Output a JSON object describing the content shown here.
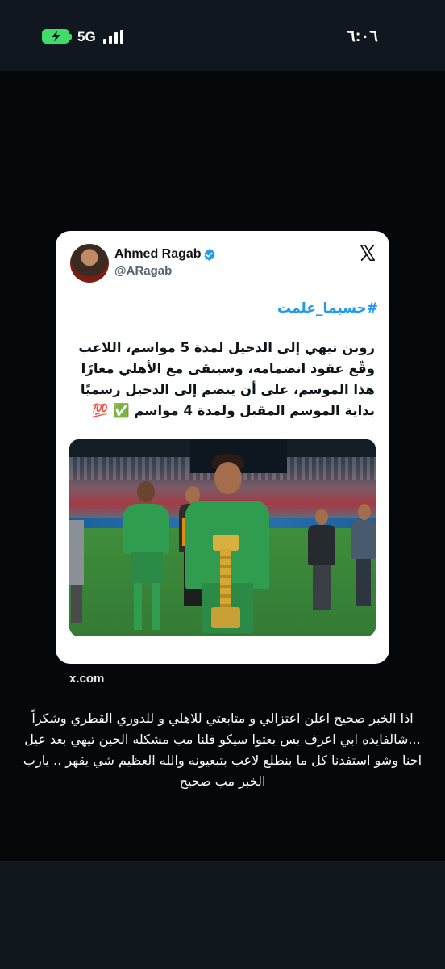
{
  "status_bar": {
    "network": "5G",
    "time": "٦:٠٦",
    "battery_color": "#3fdc6a",
    "icons": [
      "battery-charging-icon",
      "signal-bars-icon"
    ]
  },
  "tweet": {
    "author_name": "Ahmed Ragab",
    "handle": "@ARagab",
    "hashtag": "#حسبما_علمت",
    "text": "روبن تيهي إلى الدحيل لمدة 5 مواسم، اللاعب وقّع عقود انضمامه، وسيبقى مع الأهلي معارًا هذا الموسم، على أن ينضم إلى الدحيل رسميًا بداية الموسم المقبل ولمدة 4 مواسم ✅ 💯",
    "link_color": "#1d9bf0"
  },
  "source_domain": "x.com",
  "caption": "اذا الخبر صحيح اعلن اعتزالي و متابعتي للاهلي و للدوري القطري وشكراً ...شالفايده ابي اعرف بس بعتوا سيكو قلنا مب مشكله الحين تيهي بعد عيل احنا وشو استفدنا كل ما بنطلع لاعب بتبعيونه والله العظيم شي يقهر .. يارب الخبر مب صحيح"
}
